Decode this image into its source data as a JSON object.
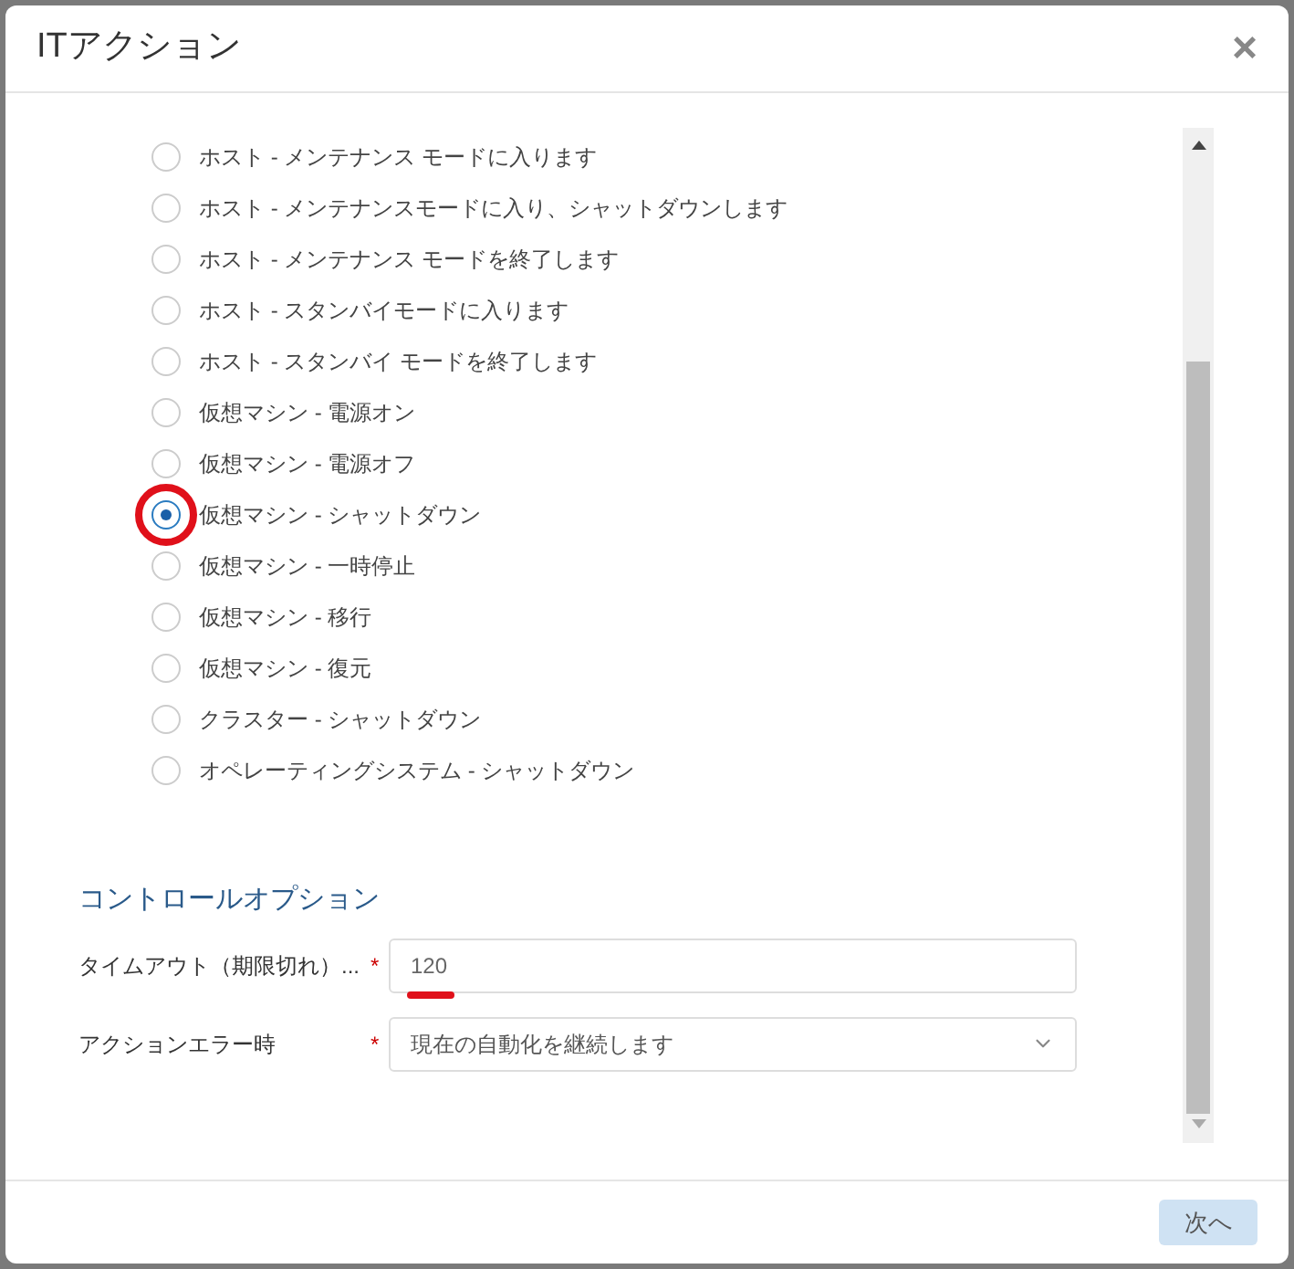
{
  "dialog": {
    "title": "ITアクション",
    "close": "×"
  },
  "options": [
    {
      "label": "ホスト - メンテナンス モードに入ります",
      "selected": false,
      "annotated": false
    },
    {
      "label": "ホスト - メンテナンスモードに入り、シャットダウンします",
      "selected": false,
      "annotated": false
    },
    {
      "label": "ホスト - メンテナンス モードを終了します",
      "selected": false,
      "annotated": false
    },
    {
      "label": "ホスト - スタンバイモードに入ります",
      "selected": false,
      "annotated": false
    },
    {
      "label": "ホスト - スタンバイ モードを終了します",
      "selected": false,
      "annotated": false
    },
    {
      "label": "仮想マシン - 電源オン",
      "selected": false,
      "annotated": false
    },
    {
      "label": "仮想マシン - 電源オフ",
      "selected": false,
      "annotated": false
    },
    {
      "label": "仮想マシン - シャットダウン",
      "selected": true,
      "annotated": true
    },
    {
      "label": "仮想マシン - 一時停止",
      "selected": false,
      "annotated": false
    },
    {
      "label": "仮想マシン - 移行",
      "selected": false,
      "annotated": false
    },
    {
      "label": "仮想マシン - 復元",
      "selected": false,
      "annotated": false
    },
    {
      "label": "クラスター - シャットダウン",
      "selected": false,
      "annotated": false
    },
    {
      "label": "オペレーティングシステム - シャットダウン",
      "selected": false,
      "annotated": false
    }
  ],
  "control_options": {
    "heading": "コントロールオプション",
    "fields": [
      {
        "kind": "input",
        "label": "タイムアウト（期限切れ）...",
        "required": "*",
        "value": "120",
        "annotated": true
      },
      {
        "kind": "select",
        "label": "アクションエラー時",
        "required": "*",
        "value": "現在の自動化を継続します",
        "annotated": false
      }
    ]
  },
  "footer": {
    "next": "次へ"
  }
}
